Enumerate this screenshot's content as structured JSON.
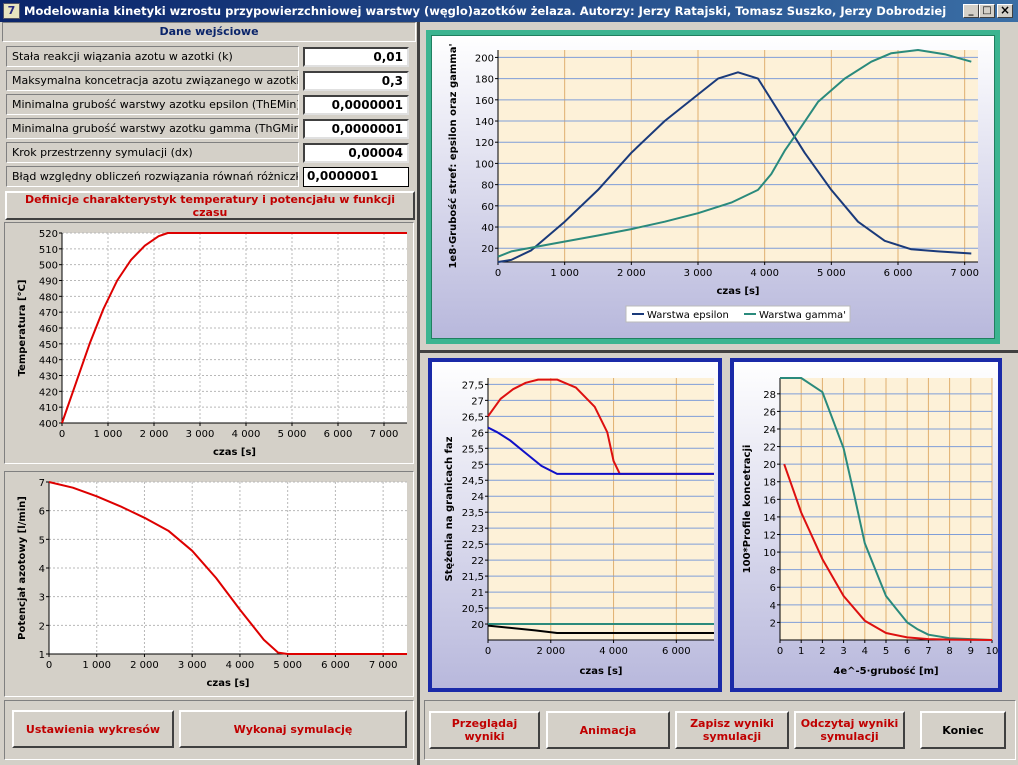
{
  "window": {
    "title": "Modelowania kinetyki wzrostu przypowierzchniowej warstwy (węglo)azotków żelaza. Autorzy: Jerzy Ratajski, Tomasz Suszko, Jerzy Dobrodziej",
    "icon_text": "7",
    "minimize": "_",
    "maximize": "□",
    "close": "×"
  },
  "input_panel": {
    "header": "Dane wejściowe",
    "params": [
      {
        "label": "Stała reakcji wiązania azotu w azotki (k)",
        "value": "0,01"
      },
      {
        "label": "Maksymalna koncetracja azotu związanego w azotki (Smax)",
        "value": "0,3"
      },
      {
        "label": "Minimalna grubość warstwy azotku epsilon (ThEMin)",
        "value": "0,0000001"
      },
      {
        "label": "Minimalna grubość warstwy azotku  gamma (ThGMin)",
        "value": "0,0000001"
      },
      {
        "label": "Krok przestrzenny symulacji (dx)",
        "value": "0,00004"
      },
      {
        "label": "Błąd względny obliczeń rozwiązania równań różniczkowych",
        "value": "0,0000001"
      }
    ],
    "definitions_button": "Definicje charakterystyk temperatury i potencjału w funkcji czasu"
  },
  "buttons": {
    "settings": "Ustawienia wykresów",
    "run": "Wykonaj symulację",
    "browse": "Przeglądaj wyniki",
    "animation": "Animacja",
    "save": "Zapisz wyniki symulacji",
    "load": "Odczytaj wyniki symulacji",
    "exit": "Koniec"
  },
  "chart_data": [
    {
      "id": "temperature",
      "type": "line",
      "xlabel": "czas [s]",
      "ylabel": "Temperatura [°C]",
      "xlim": [
        0,
        7500
      ],
      "ylim": [
        400,
        520
      ],
      "xticks": [
        0,
        1000,
        2000,
        3000,
        4000,
        5000,
        6000,
        7000
      ],
      "xtick_labels": [
        "0",
        "1 000",
        "2 000",
        "3 000",
        "4 000",
        "5 000",
        "6 000",
        "7 000"
      ],
      "yticks": [
        400,
        410,
        420,
        430,
        440,
        450,
        460,
        470,
        480,
        490,
        500,
        510,
        520
      ],
      "ytick_labels": [
        "400",
        "410",
        "420",
        "430",
        "440",
        "450",
        "460",
        "470",
        "480",
        "490",
        "500",
        "510",
        "520"
      ],
      "grid": true,
      "background": "#ffffff",
      "gridcolor": "#b8b8b8",
      "griddash": "2,2",
      "series": [
        {
          "color": "#dd0000",
          "points": [
            [
              0,
              400
            ],
            [
              300,
              425
            ],
            [
              600,
              450
            ],
            [
              900,
              472
            ],
            [
              1200,
              490
            ],
            [
              1500,
              503
            ],
            [
              1800,
              512
            ],
            [
              2100,
              518
            ],
            [
              2300,
              520
            ],
            [
              7500,
              520
            ]
          ]
        }
      ]
    },
    {
      "id": "potential",
      "type": "line",
      "xlabel": "czas [s]",
      "ylabel": "Potencjał azotowy [l/min]",
      "xlim": [
        0,
        7500
      ],
      "ylim": [
        1,
        7
      ],
      "xticks": [
        0,
        1000,
        2000,
        3000,
        4000,
        5000,
        6000,
        7000
      ],
      "xtick_labels": [
        "0",
        "1 000",
        "2 000",
        "3 000",
        "4 000",
        "5 000",
        "6 000",
        "7 000"
      ],
      "yticks": [
        1,
        2,
        3,
        4,
        5,
        6,
        7
      ],
      "ytick_labels": [
        "1",
        "2",
        "3",
        "4",
        "5",
        "6",
        "7"
      ],
      "grid": true,
      "background": "#ffffff",
      "gridcolor": "#b8b8b8",
      "griddash": "2,2",
      "series": [
        {
          "color": "#dd0000",
          "points": [
            [
              0,
              7
            ],
            [
              500,
              6.8
            ],
            [
              1000,
              6.5
            ],
            [
              1500,
              6.15
            ],
            [
              2000,
              5.75
            ],
            [
              2500,
              5.3
            ],
            [
              3000,
              4.6
            ],
            [
              3500,
              3.65
            ],
            [
              4000,
              2.55
            ],
            [
              4500,
              1.5
            ],
            [
              4800,
              1.05
            ],
            [
              5000,
              1
            ],
            [
              7500,
              1
            ]
          ]
        }
      ]
    },
    {
      "id": "layers",
      "type": "line",
      "xlabel": "czas [s]",
      "ylabel": "1e8·Grubość stref: epsilon oraz gamma'",
      "xlim": [
        0,
        7200
      ],
      "ylim": [
        7,
        207
      ],
      "xticks": [
        0,
        1000,
        2000,
        3000,
        4000,
        5000,
        6000,
        7000
      ],
      "xtick_labels": [
        "0",
        "1 000",
        "2 000",
        "3 000",
        "4 000",
        "5 000",
        "6 000",
        "7 000"
      ],
      "yticks": [
        20,
        40,
        60,
        80,
        100,
        120,
        140,
        160,
        180,
        200
      ],
      "ytick_labels": [
        "20",
        "40",
        "60",
        "80",
        "100",
        "120",
        "140",
        "160",
        "180",
        "200"
      ],
      "grid": true,
      "background": "#fdf1d8",
      "gridcolor": "#7f9ed8",
      "vgridcolor": "#e0b070",
      "legend": {
        "position": "bottom-center"
      },
      "series": [
        {
          "name": "Warstwa epsilon",
          "color": "#1a3a7a",
          "points": [
            [
              0,
              7
            ],
            [
              200,
              9
            ],
            [
              500,
              18
            ],
            [
              1000,
              45
            ],
            [
              1500,
              75
            ],
            [
              2000,
              110
            ],
            [
              2500,
              140
            ],
            [
              3000,
              165
            ],
            [
              3300,
              180
            ],
            [
              3600,
              186
            ],
            [
              3900,
              180
            ],
            [
              4200,
              150
            ],
            [
              4600,
              110
            ],
            [
              5000,
              75
            ],
            [
              5400,
              45
            ],
            [
              5800,
              27
            ],
            [
              6200,
              19
            ],
            [
              6600,
              17
            ],
            [
              7100,
              15
            ]
          ]
        },
        {
          "name": "Warstwa gamma'",
          "color": "#2a8a7c",
          "points": [
            [
              0,
              12
            ],
            [
              200,
              17
            ],
            [
              800,
              24
            ],
            [
              1500,
              32
            ],
            [
              2000,
              38
            ],
            [
              2500,
              45
            ],
            [
              3000,
              53
            ],
            [
              3500,
              63
            ],
            [
              3900,
              75
            ],
            [
              4100,
              90
            ],
            [
              4300,
              112
            ],
            [
              4500,
              130
            ],
            [
              4800,
              158
            ],
            [
              5200,
              180
            ],
            [
              5600,
              196
            ],
            [
              5900,
              204
            ],
            [
              6300,
              207
            ],
            [
              6700,
              203
            ],
            [
              7100,
              196
            ]
          ]
        }
      ]
    },
    {
      "id": "concentrations",
      "type": "line",
      "xlabel": "czas [s]",
      "ylabel": "Stężenia na granicach faz",
      "xlim": [
        0,
        7200
      ],
      "ylim": [
        19.5,
        27.7
      ],
      "xticks": [
        0,
        2000,
        4000,
        6000
      ],
      "xtick_labels": [
        "0",
        "2 000",
        "4 000",
        "6 000"
      ],
      "yticks": [
        20,
        20.5,
        21,
        21.5,
        22,
        22.5,
        23,
        23.5,
        24,
        24.5,
        25,
        25.5,
        26,
        26.5,
        27,
        27.5
      ],
      "ytick_labels": [
        "20",
        "20,5",
        "21",
        "21,5",
        "22",
        "22,5",
        "23",
        "23,5",
        "24",
        "24,5",
        "25",
        "25,5",
        "26",
        "26,5",
        "27",
        "27,5"
      ],
      "grid": true,
      "background": "#fdf1d8",
      "gridcolor": "#7f9ed8",
      "vgridcolor": "#e0b070",
      "series": [
        {
          "color": "#dd1010",
          "points": [
            [
              0,
              26.5
            ],
            [
              400,
              27.05
            ],
            [
              800,
              27.35
            ],
            [
              1200,
              27.55
            ],
            [
              1600,
              27.65
            ],
            [
              2200,
              27.65
            ],
            [
              2800,
              27.4
            ],
            [
              3400,
              26.8
            ],
            [
              3800,
              26
            ],
            [
              4000,
              25.1
            ],
            [
              4200,
              24.7
            ],
            [
              7200,
              24.7
            ]
          ]
        },
        {
          "color": "#1010c8",
          "points": [
            [
              0,
              26.15
            ],
            [
              300,
              26
            ],
            [
              700,
              25.75
            ],
            [
              1200,
              25.35
            ],
            [
              1700,
              24.95
            ],
            [
              2200,
              24.7
            ],
            [
              7200,
              24.7
            ]
          ]
        },
        {
          "color": "#2a8a7c",
          "points": [
            [
              0,
              20
            ],
            [
              7200,
              20
            ]
          ]
        },
        {
          "color": "#000000",
          "points": [
            [
              0,
              19.95
            ],
            [
              1500,
              19.8
            ],
            [
              2200,
              19.72
            ],
            [
              7200,
              19.72
            ]
          ]
        }
      ]
    },
    {
      "id": "profiles",
      "type": "line",
      "xlabel": "4e^-5·grubość [m]",
      "ylabel": "100*Profile koncetracji",
      "xlim": [
        0,
        10
      ],
      "ylim": [
        0,
        29.8
      ],
      "xticks": [
        0,
        1,
        2,
        3,
        4,
        5,
        6,
        7,
        8,
        9,
        10
      ],
      "xtick_labels": [
        "0",
        "1",
        "2",
        "3",
        "4",
        "5",
        "6",
        "7",
        "8",
        "9",
        "10"
      ],
      "yticks": [
        2,
        4,
        6,
        8,
        10,
        12,
        14,
        16,
        18,
        20,
        22,
        24,
        26,
        28
      ],
      "ytick_labels": [
        "2",
        "4",
        "6",
        "8",
        "10",
        "12",
        "14",
        "16",
        "18",
        "20",
        "22",
        "24",
        "26",
        "28"
      ],
      "grid": true,
      "background": "#fdf1d8",
      "gridcolor": "#7f9ed8",
      "vgridcolor": "#e0b070",
      "series": [
        {
          "color": "#2a8a7c",
          "points": [
            [
              0,
              29.8
            ],
            [
              1,
              29.8
            ],
            [
              2,
              28.2
            ],
            [
              2.5,
              25
            ],
            [
              3,
              21.8
            ],
            [
              3.5,
              16.5
            ],
            [
              4,
              11
            ],
            [
              4.5,
              8
            ],
            [
              5,
              5
            ],
            [
              5.5,
              3.5
            ],
            [
              6,
              2
            ],
            [
              6.5,
              1.2
            ],
            [
              7,
              0.6
            ],
            [
              8,
              0.2
            ],
            [
              9,
              0.1
            ],
            [
              10,
              0
            ]
          ]
        },
        {
          "color": "#dd1010",
          "points": [
            [
              0.2,
              20
            ],
            [
              1,
              14.5
            ],
            [
              2,
              9.2
            ],
            [
              3,
              5
            ],
            [
              4,
              2.2
            ],
            [
              5,
              0.8
            ],
            [
              6,
              0.3
            ],
            [
              7,
              0.1
            ],
            [
              8,
              0.05
            ],
            [
              10,
              0
            ]
          ]
        }
      ]
    }
  ]
}
